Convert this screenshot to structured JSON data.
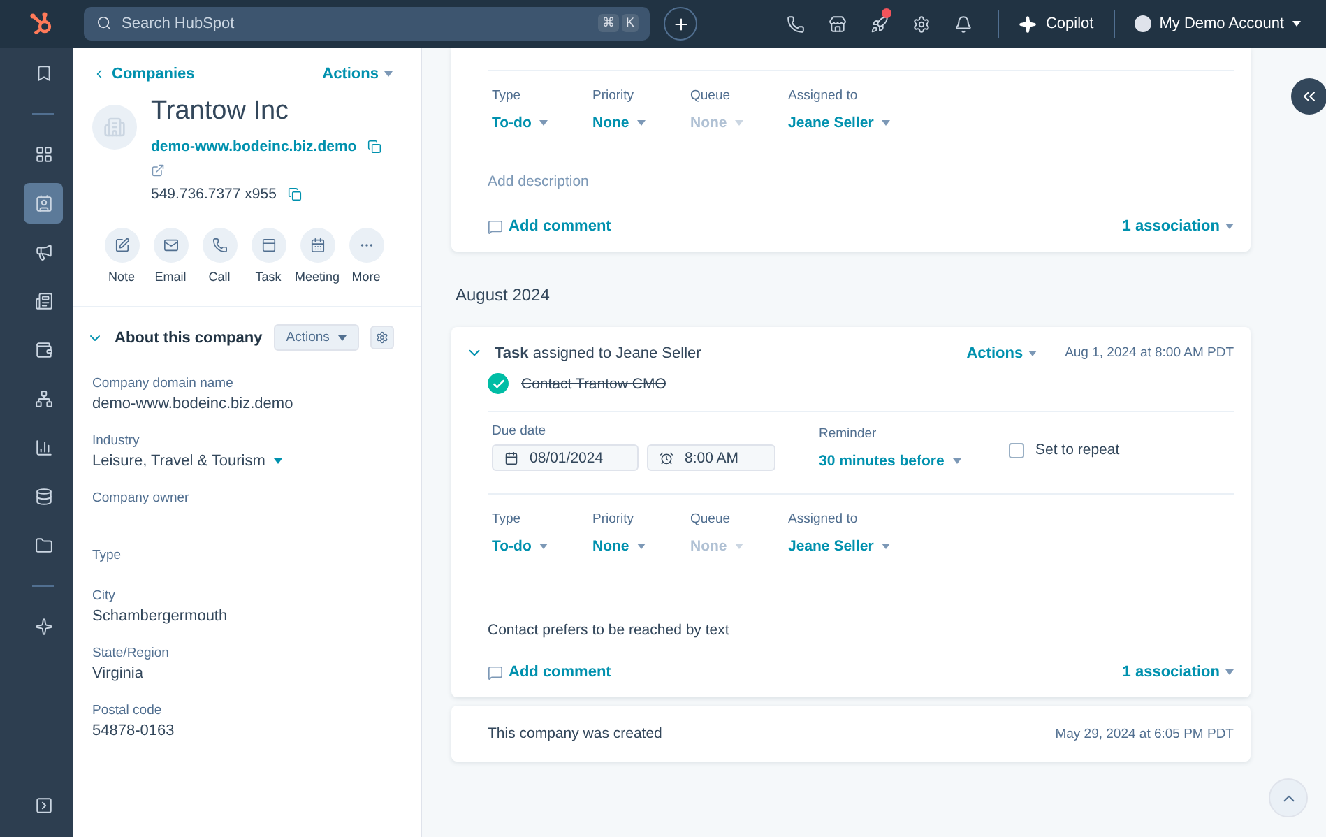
{
  "top_bar": {
    "search": {
      "placeholder": "Search HubSpot",
      "keys": [
        "⌘",
        "K"
      ]
    },
    "notifications": true,
    "copilot": "Copilot",
    "account": "My Demo Account"
  },
  "nav": {
    "groups": [
      [
        {
          "kind": "bookmark",
          "selected": false
        }
      ],
      [
        {
          "kind": "grid",
          "selected": false
        },
        {
          "kind": "contacts",
          "selected": true
        },
        {
          "kind": "megaphone",
          "selected": false
        },
        {
          "kind": "document",
          "selected": false
        },
        {
          "kind": "wallet",
          "selected": false
        },
        {
          "kind": "network",
          "selected": false
        },
        {
          "kind": "chart",
          "selected": false
        },
        {
          "kind": "database",
          "selected": false
        },
        {
          "kind": "folder",
          "selected": false
        }
      ],
      [
        {
          "kind": "sparkle",
          "selected": false
        }
      ]
    ]
  },
  "record": {
    "breadcrumb": "Companies",
    "actions": "Actions",
    "name": "Trantow Inc",
    "domain": "demo-www.bodeinc.biz.demo",
    "phone": "549.736.7377 x955",
    "quick_actions": [
      {
        "kind": "note",
        "label": "Note"
      },
      {
        "kind": "email",
        "label": "Email"
      },
      {
        "kind": "call",
        "label": "Call"
      },
      {
        "kind": "task",
        "label": "Task"
      },
      {
        "kind": "meeting",
        "label": "Meeting"
      },
      {
        "kind": "more",
        "label": "More"
      }
    ],
    "about": {
      "title": "About this company",
      "expanded": true,
      "actions": "Actions",
      "properties": [
        {
          "label": "Company domain name",
          "value": "demo-www.bodeinc.biz.demo",
          "kind": "text"
        },
        {
          "label": "Industry",
          "value": "Leisure, Travel & Tourism",
          "kind": "dropdown"
        },
        {
          "label": "Company owner",
          "kind": "empty"
        },
        {
          "label": "Type",
          "kind": "none"
        },
        {
          "label": "City",
          "value": "Schambergermouth",
          "kind": "text"
        },
        {
          "label": "State/Region",
          "value": "Virginia",
          "kind": "text"
        },
        {
          "label": "Postal code",
          "value": "54878-0163",
          "kind": "text"
        }
      ]
    }
  },
  "timeline": [
    {
      "kind": "task",
      "cut": true,
      "fields": [
        {
          "label": "Type",
          "value": "To-do",
          "disabled": false
        },
        {
          "label": "Priority",
          "value": "None",
          "disabled": false
        },
        {
          "label": "Queue",
          "value": "None",
          "disabled": true
        },
        {
          "label": "Assigned to",
          "value": "Jeane Seller",
          "disabled": false
        }
      ],
      "description": {
        "placeholder": "Add description"
      },
      "comment": "Add comment",
      "association": "1 association"
    },
    {
      "kind": "month",
      "label": "August 2024"
    },
    {
      "kind": "task",
      "cut": false,
      "heading": "**Task** assigned to Jeane Seller",
      "actions": "Actions",
      "timestamp": "Aug 1, 2024 at 8:00 AM PDT",
      "title": "Contact Trantow CMO",
      "completed": true,
      "due": {
        "label": "Due date",
        "date": "08/01/2024",
        "time": "8:00 AM"
      },
      "reminder": {
        "label": "Reminder",
        "value": "30 minutes before"
      },
      "repeat": {
        "label": "Set to repeat",
        "checked": false
      },
      "fields": [
        {
          "label": "Type",
          "value": "To-do",
          "disabled": false
        },
        {
          "label": "Priority",
          "value": "None",
          "disabled": false
        },
        {
          "label": "Queue",
          "value": "None",
          "disabled": true
        },
        {
          "label": "Assigned to",
          "value": "Jeane Seller",
          "disabled": false
        }
      ],
      "description": {
        "value": "Contact prefers to be reached by text"
      },
      "comment": "Add comment",
      "association": "1 association"
    },
    {
      "kind": "event",
      "text": "This company was created",
      "timestamp": "May 29, 2024 at 6:05 PM PDT"
    }
  ]
}
